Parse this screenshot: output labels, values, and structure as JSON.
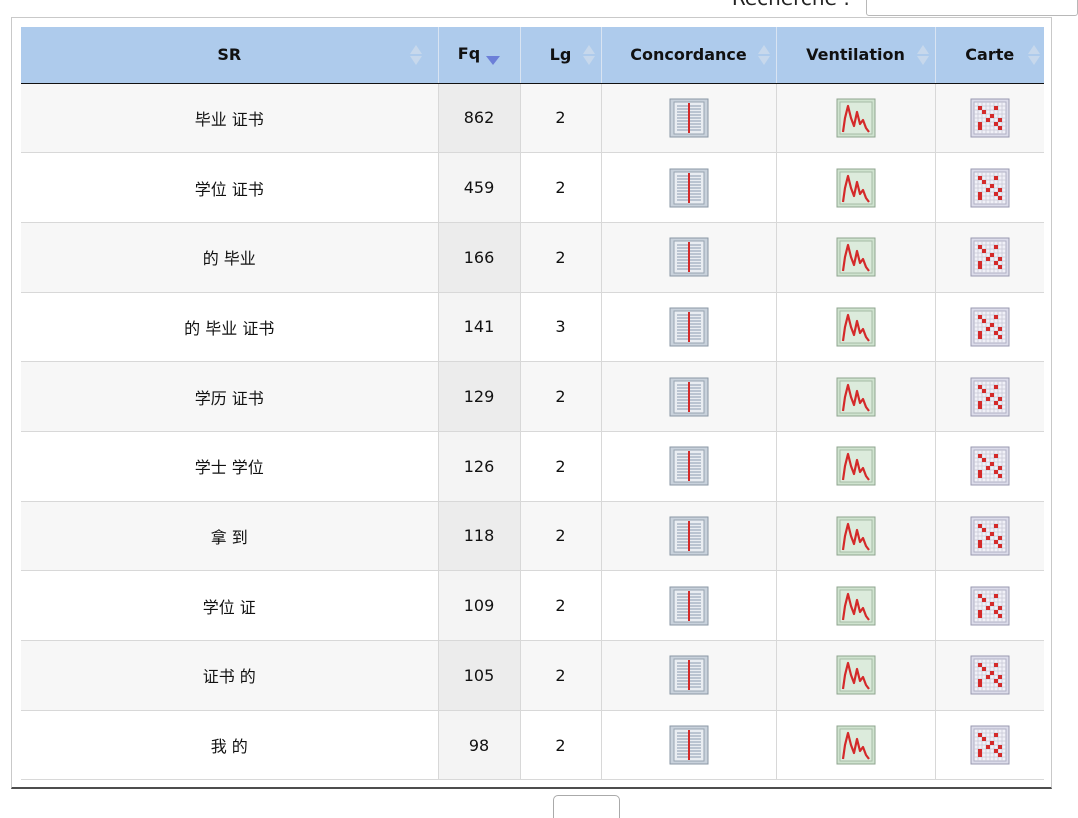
{
  "search": {
    "label": "Recherche :",
    "value": ""
  },
  "columns": [
    {
      "label": "SR",
      "sort": "both"
    },
    {
      "label": "Fq",
      "sort": "desc"
    },
    {
      "label": "Lg",
      "sort": "both"
    },
    {
      "label": "Concordance",
      "sort": "both"
    },
    {
      "label": "Ventilation",
      "sort": "both"
    },
    {
      "label": "Carte",
      "sort": "both"
    }
  ],
  "rows": [
    {
      "sr": "毕业 证书",
      "fq": "862",
      "lg": "2"
    },
    {
      "sr": "学位 证书",
      "fq": "459",
      "lg": "2"
    },
    {
      "sr": "的 毕业",
      "fq": "166",
      "lg": "2"
    },
    {
      "sr": "的 毕业 证书",
      "fq": "141",
      "lg": "3"
    },
    {
      "sr": "学历 证书",
      "fq": "129",
      "lg": "2"
    },
    {
      "sr": "学士 学位",
      "fq": "126",
      "lg": "2"
    },
    {
      "sr": "拿 到",
      "fq": "118",
      "lg": "2"
    },
    {
      "sr": "学位 证",
      "fq": "109",
      "lg": "2"
    },
    {
      "sr": "证书 的",
      "fq": "105",
      "lg": "2"
    },
    {
      "sr": "我 的",
      "fq": "98",
      "lg": "2"
    }
  ],
  "icons": {
    "concordance": "concordance-icon",
    "ventilation": "ventilation-icon",
    "carte": "carte-icon"
  },
  "colors": {
    "header_bg": "#aecbec",
    "sort_active": "#6c7fd8",
    "icon_red": "#d42a2a"
  }
}
